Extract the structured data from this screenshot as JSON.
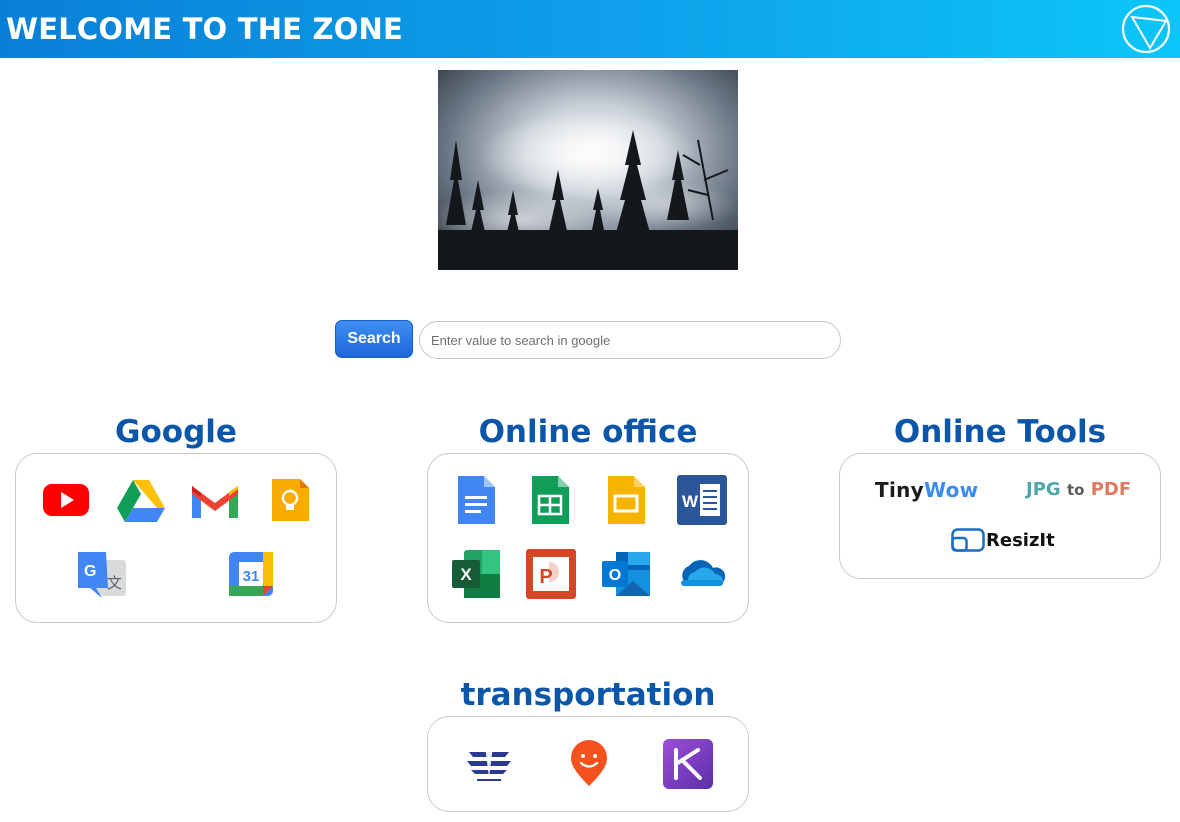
{
  "header": {
    "title": "WELCOME TO THE ZONE",
    "logo_icon": "globe-triangle-icon"
  },
  "hero": {
    "alt": "misty forest photo"
  },
  "search": {
    "button_label": "Search",
    "placeholder": "Enter value to search in google",
    "value": ""
  },
  "sections": {
    "google": {
      "title": "Google",
      "items": [
        {
          "name": "YouTube",
          "icon": "youtube-icon"
        },
        {
          "name": "Google Drive",
          "icon": "google-drive-icon"
        },
        {
          "name": "Gmail",
          "icon": "gmail-icon"
        },
        {
          "name": "Google Keep",
          "icon": "google-keep-icon"
        },
        {
          "name": "Google Translate",
          "icon": "google-translate-icon"
        },
        {
          "name": "Google Calendar",
          "icon": "google-calendar-icon",
          "label": "31"
        }
      ]
    },
    "office": {
      "title": "Online office",
      "items": [
        {
          "name": "Google Docs",
          "icon": "google-docs-icon"
        },
        {
          "name": "Google Sheets",
          "icon": "google-sheets-icon"
        },
        {
          "name": "Google Slides",
          "icon": "google-slides-icon"
        },
        {
          "name": "Word",
          "icon": "word-icon",
          "label": "W"
        },
        {
          "name": "Excel",
          "icon": "excel-icon",
          "label": "X"
        },
        {
          "name": "PowerPoint",
          "icon": "powerpoint-icon",
          "label": "P"
        },
        {
          "name": "Outlook",
          "icon": "outlook-icon",
          "label": "O"
        },
        {
          "name": "OneDrive",
          "icon": "onedrive-icon"
        }
      ]
    },
    "tools": {
      "title": "Online Tools",
      "tinywow": {
        "part1": "Tiny",
        "part2": "Wow"
      },
      "jpg2pdf": {
        "part1": "JPG",
        "part2": "to",
        "part3": "PDF"
      },
      "resizit": {
        "name": "ResizIt",
        "icon": "resizit-icon"
      }
    },
    "transport": {
      "title": "transportation",
      "items": [
        {
          "name": "Israel Railways",
          "icon": "israel-railways-icon"
        },
        {
          "name": "Moovit",
          "icon": "moovit-icon"
        },
        {
          "name": "Kavkav",
          "icon": "kavkav-icon"
        }
      ]
    }
  },
  "colors": {
    "header_start": "#0a7fd6",
    "header_end": "#0cc6f8",
    "section_title": "#0c56a9",
    "search_button": "#1f66da"
  }
}
